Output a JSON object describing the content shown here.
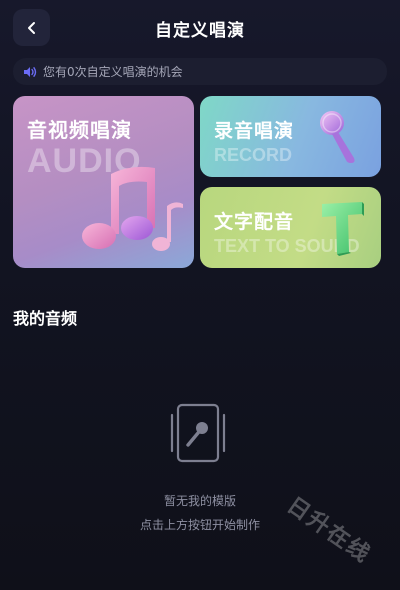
{
  "header": {
    "title": "自定义唱演"
  },
  "notice": {
    "text": "您有0次自定义唱演的机会"
  },
  "cards": [
    {
      "title": "音视频唱演",
      "subtitle": "AUDIO"
    },
    {
      "title": "录音唱演",
      "subtitle": "RECORD"
    },
    {
      "title": "文字配音",
      "subtitle": "TEXT TO SOUND"
    }
  ],
  "section": {
    "title": "我的音频"
  },
  "empty": {
    "line1": "暂无我的模版",
    "line2": "点击上方按钮开始制作"
  },
  "watermark": {
    "text": "日升在线"
  },
  "colors": {
    "background": "#121422",
    "accent_notice_icon": "#6b6cf5"
  },
  "icons": [
    "back-arrow-icon",
    "speaker-icon",
    "music-note-icon",
    "microphone-icon",
    "letter-t-icon",
    "empty-template-icon"
  ]
}
